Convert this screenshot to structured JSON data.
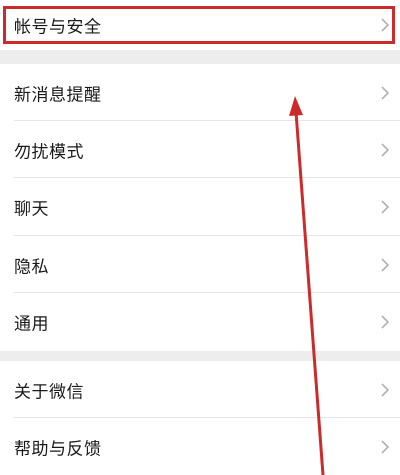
{
  "settings": {
    "group1": [
      {
        "label": "帐号与安全"
      }
    ],
    "group2": [
      {
        "label": "新消息提醒"
      },
      {
        "label": "勿扰模式"
      },
      {
        "label": "聊天"
      },
      {
        "label": "隐私"
      },
      {
        "label": "通用"
      }
    ],
    "group3": [
      {
        "label": "关于微信"
      },
      {
        "label": "帮助与反馈"
      }
    ]
  },
  "colors": {
    "highlight": "#cc2b2b",
    "arrow": "#cc2b2b",
    "background": "#ededed"
  },
  "icons": {
    "row_chevron": "chevron-right-icon"
  }
}
